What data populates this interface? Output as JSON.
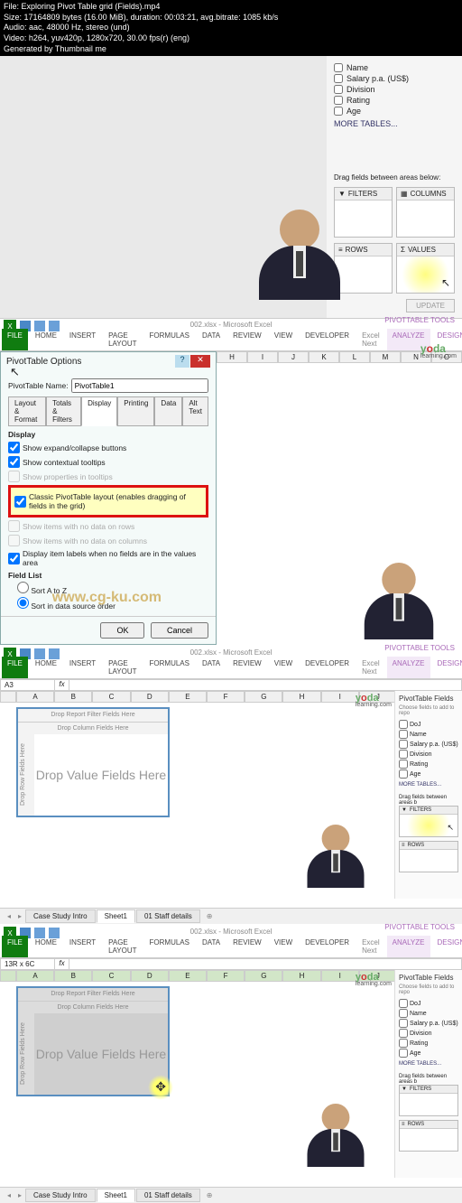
{
  "overlay": {
    "l1": "File: Exploring Pivot Table grid (Fields).mp4",
    "l2": "Size: 17164809 bytes (16.00 MiB), duration: 00:03:21, avg.bitrate: 1085 kb/s",
    "l3": "Audio: aac, 48000 Hz, stereo (und)",
    "l4": "Video: h264, yuv420p, 1280x720, 30.00 fps(r) (eng)",
    "l5": "Generated by Thumbnail me"
  },
  "brand": {
    "pre": "y",
    "mid": "o",
    "post": "da",
    "sub": "learning.com"
  },
  "pane1": {
    "fields": [
      "Name",
      "Salary p.a. (US$)",
      "Division",
      "Rating",
      "Age"
    ],
    "more": "MORE TABLES...",
    "drag": "Drag fields between areas below:",
    "areas": {
      "filters": "FILTERS",
      "columns": "COLUMNS",
      "rows": "ROWS",
      "values": "VALUES"
    },
    "update": "UPDATE"
  },
  "excel": {
    "title": "002.xlsx - Microsoft Excel",
    "context": "PIVOTTABLE TOOLS",
    "tabs": {
      "file": "FILE",
      "home": "HOME",
      "insert": "INSERT",
      "layout": "PAGE LAYOUT",
      "formulas": "FORMULAS",
      "data": "DATA",
      "review": "REVIEW",
      "view": "VIEW",
      "developer": "DEVELOPER",
      "next": "Excel Next",
      "analyze": "ANALYZE",
      "design": "DESIGN"
    }
  },
  "dialog": {
    "title": "PivotTable Options",
    "name_label": "PivotTable Name:",
    "name_value": "PivotTable1",
    "tabs": {
      "layout": "Layout & Format",
      "totals": "Totals & Filters",
      "display": "Display",
      "printing": "Printing",
      "data": "Data",
      "alt": "Alt Text"
    },
    "display_section": "Display",
    "expand": "Show expand/collapse buttons",
    "tooltips": "Show contextual tooltips",
    "properties": "Show properties in tooltips",
    "classic": "Classic PivotTable layout (enables dragging of fields in the grid)",
    "norows": "Show items with no data on rows",
    "nocols": "Show items with no data on columns",
    "itemlabels": "Display item labels when no fields are in the values area",
    "fieldlist": "Field List",
    "atoz": "Sort A to Z",
    "source": "Sort in data source order",
    "ok": "OK",
    "cancel": "Cancel",
    "watermark": "www.cg-ku.com"
  },
  "cols": {
    "letters": [
      "A",
      "B",
      "C",
      "D",
      "E",
      "F",
      "G",
      "H",
      "I",
      "J",
      "K",
      "L",
      "M",
      "N",
      "O"
    ]
  },
  "pivot": {
    "filter": "Drop Report Filter Fields Here",
    "cols": "Drop Column Fields Here",
    "rows": "Drop Row Fields Here",
    "vals": "Drop Value Fields Here"
  },
  "namebox": {
    "v1": "A3",
    "v2": "13R x 6C"
  },
  "ptfields": {
    "title": "PivotTable Fields",
    "sub": "Choose fields to add to repo",
    "list": [
      "DoJ",
      "Name",
      "Salary p.a. (US$)",
      "Division",
      "Rating",
      "Age"
    ],
    "more": "MORE TABLES...",
    "drag": "Drag fields between areas b",
    "filters": "FILTERS",
    "rows": "ROWS"
  },
  "sheets": {
    "s1": "Case Study Intro",
    "s2": "Sheet1",
    "s3": "01 Staff details"
  }
}
